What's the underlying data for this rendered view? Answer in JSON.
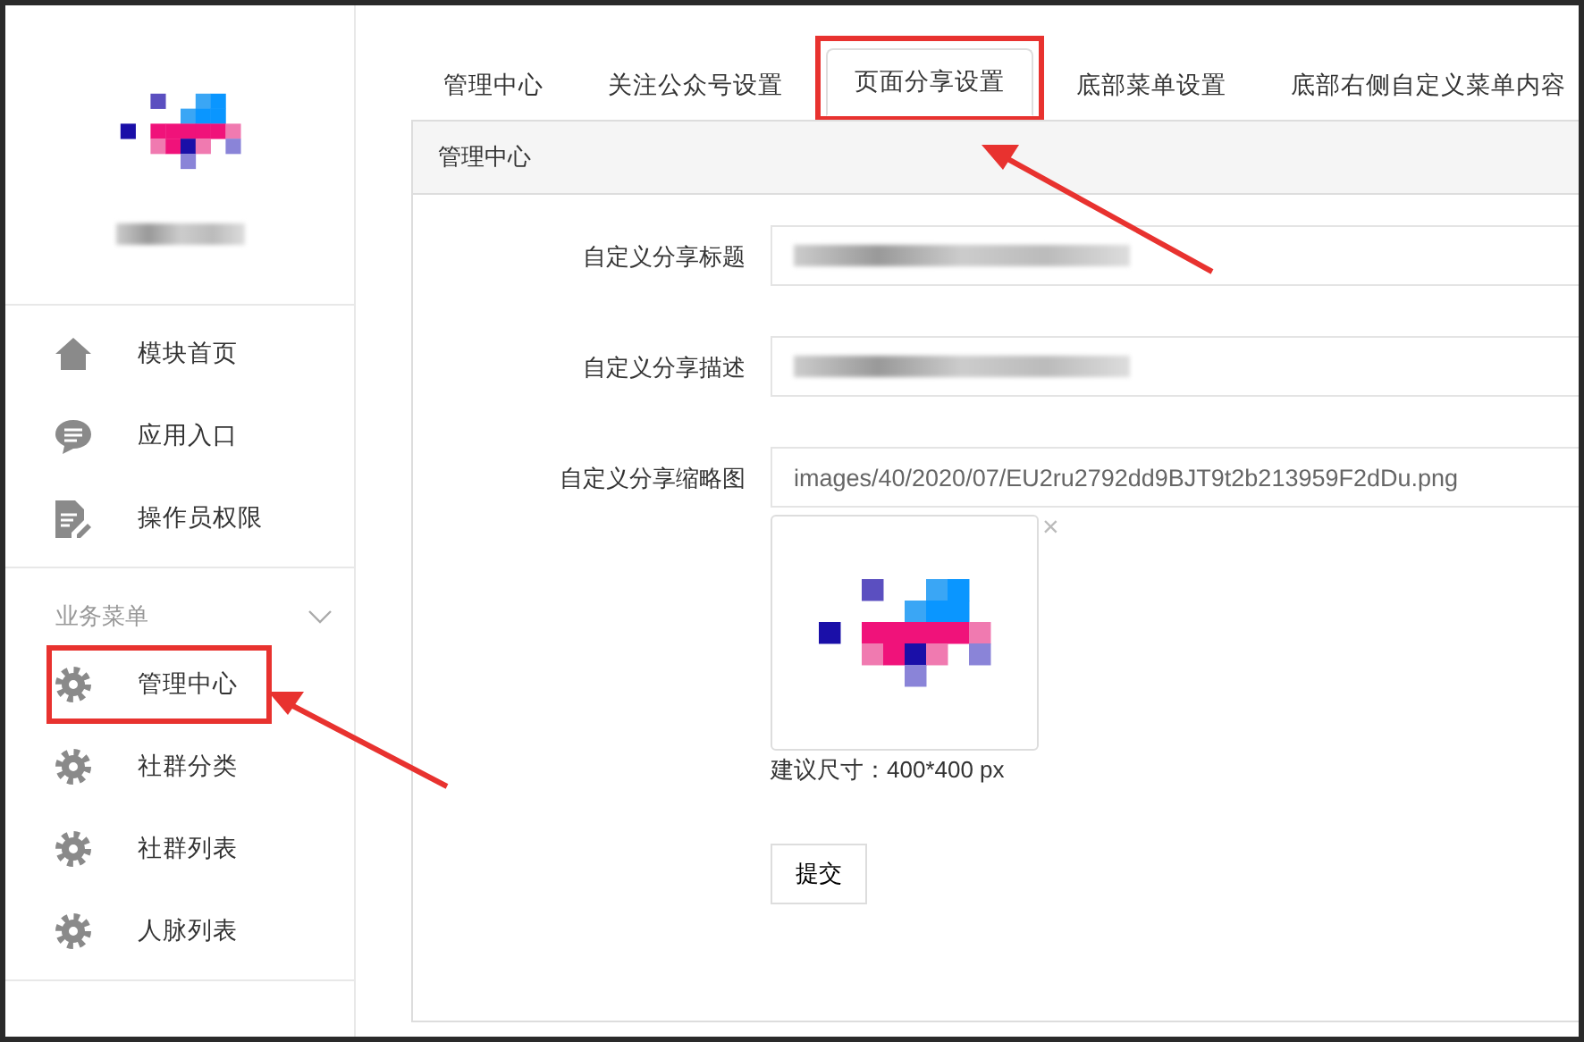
{
  "sidebar": {
    "nav_items": [
      {
        "label": "模块首页",
        "kind": "home"
      },
      {
        "label": "应用入口",
        "kind": "chat"
      },
      {
        "label": "操作员权限",
        "kind": "document"
      }
    ],
    "section": {
      "title": "业务菜单",
      "expanded": true
    },
    "menu_items": [
      {
        "label": "管理中心",
        "kind": "gear",
        "highlighted": true
      },
      {
        "label": "社群分类",
        "kind": "gear",
        "highlighted": false
      },
      {
        "label": "社群列表",
        "kind": "gear",
        "highlighted": false
      },
      {
        "label": "人脉列表",
        "kind": "gear",
        "highlighted": false
      }
    ]
  },
  "tabs": [
    {
      "label": "管理中心",
      "selected": false,
      "highlighted": false
    },
    {
      "label": "关注公众号设置",
      "selected": false,
      "highlighted": false
    },
    {
      "label": "页面分享设置",
      "selected": true,
      "highlighted": true
    },
    {
      "label": "底部菜单设置",
      "selected": false,
      "highlighted": false
    },
    {
      "label": "底部右侧自定义菜单内容",
      "selected": false,
      "highlighted": false
    }
  ],
  "panel": {
    "title": "管理中心",
    "fields": [
      {
        "kind": "redacted",
        "label": "自定义分享标题"
      },
      {
        "kind": "redacted",
        "label": "自定义分享描述"
      },
      {
        "kind": "image",
        "label": "自定义分享缩略图",
        "value": "images/40/2020/07/EU2ru2792dd9BJT9t2b213959F2dDu.png",
        "remove": "×",
        "hint": "建议尺寸：400*400 px"
      }
    ],
    "submit": "提交"
  }
}
